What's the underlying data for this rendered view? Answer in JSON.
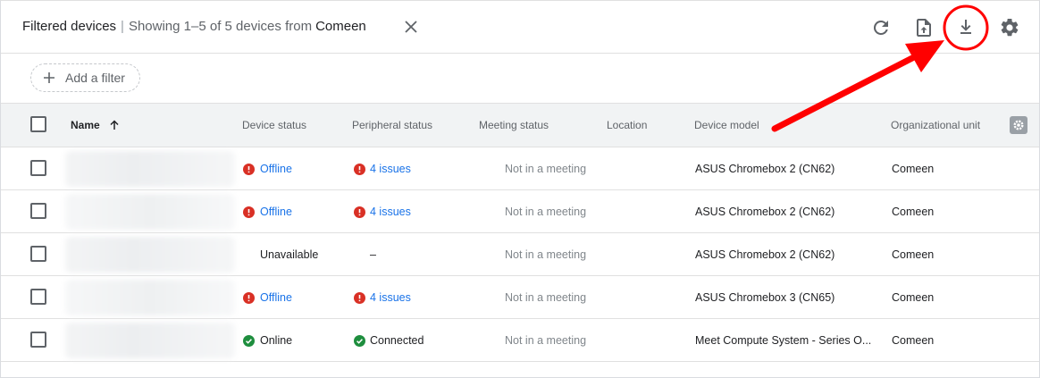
{
  "header": {
    "title": "Filtered devices",
    "separator": "|",
    "subtitle": "Showing 1–5 of 5 devices from",
    "org": "Comeen",
    "icons": [
      "close-icon",
      "refresh-icon",
      "upload-file-icon",
      "download-icon",
      "settings-gear-icon"
    ]
  },
  "filter": {
    "add_label": "Add a filter"
  },
  "columns": {
    "name": "Name",
    "device_status": "Device status",
    "peripheral_status": "Peripheral status",
    "meeting_status": "Meeting status",
    "location": "Location",
    "device_model": "Device model",
    "org_unit": "Organizational unit"
  },
  "rows": [
    {
      "device_status": "Offline",
      "device_status_kind": "error",
      "peripheral_status": "4 issues",
      "peripheral_kind": "error",
      "meeting_status": "Not in a meeting",
      "location": "",
      "device_model": "ASUS Chromebox 2 (CN62)",
      "org_unit": "Comeen"
    },
    {
      "device_status": "Offline",
      "device_status_kind": "error",
      "peripheral_status": "4 issues",
      "peripheral_kind": "error",
      "meeting_status": "Not in a meeting",
      "location": "",
      "device_model": "ASUS Chromebox 2 (CN62)",
      "org_unit": "Comeen"
    },
    {
      "device_status": "Unavailable",
      "device_status_kind": "none",
      "peripheral_status": "–",
      "peripheral_kind": "none",
      "meeting_status": "Not in a meeting",
      "location": "",
      "device_model": "ASUS Chromebox 2 (CN62)",
      "org_unit": "Comeen"
    },
    {
      "device_status": "Offline",
      "device_status_kind": "error",
      "peripheral_status": "4 issues",
      "peripheral_kind": "error",
      "meeting_status": "Not in a meeting",
      "location": "",
      "device_model": "ASUS Chromebox 3 (CN65)",
      "org_unit": "Comeen"
    },
    {
      "device_status": "Online",
      "device_status_kind": "ok",
      "peripheral_status": "Connected",
      "peripheral_kind": "ok",
      "meeting_status": "Not in a meeting",
      "location": "",
      "device_model": "Meet Compute System - Series O...",
      "org_unit": "Comeen"
    }
  ],
  "colors": {
    "link": "#1a73e8",
    "error": "#d93025",
    "ok": "#1e8e3e",
    "annotation": "#ff0000",
    "header_bg": "#f1f3f4"
  }
}
